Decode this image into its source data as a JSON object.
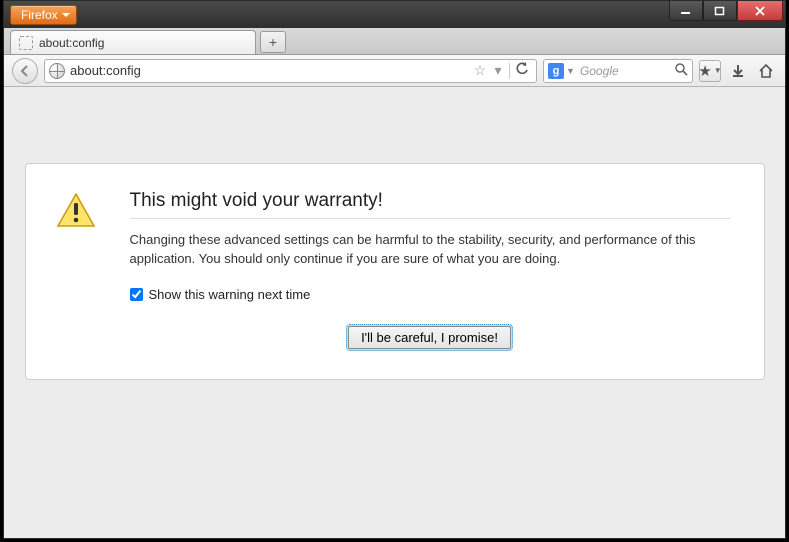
{
  "app": {
    "menu_label": "Firefox"
  },
  "tab": {
    "title": "about:config"
  },
  "url": {
    "value": "about:config"
  },
  "search": {
    "engine_letter": "g",
    "placeholder": "Google"
  },
  "warning": {
    "title": "This might void your warranty!",
    "body": "Changing these advanced settings can be harmful to the stability, security, and performance of this application. You should only continue if you are sure of what you are doing.",
    "checkbox_label": "Show this warning next time",
    "button_label": "I'll be careful, I promise!"
  }
}
